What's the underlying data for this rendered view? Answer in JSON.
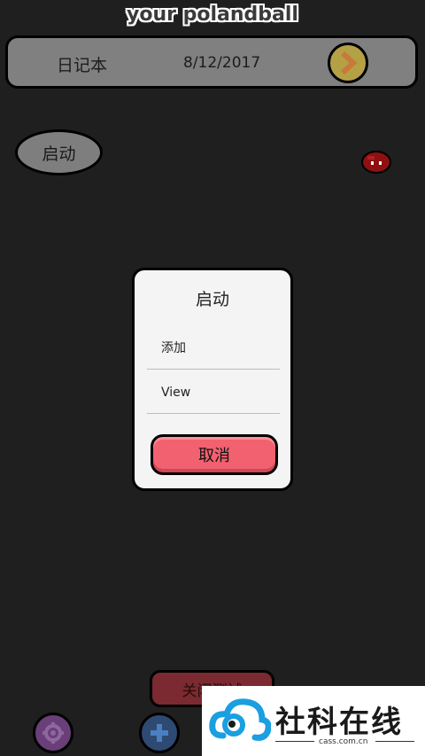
{
  "app": {
    "title": "your polandball"
  },
  "header": {
    "notebook_label": "日记本",
    "date": "8/12/2017"
  },
  "main": {
    "start_label": "启动"
  },
  "dialog": {
    "title": "启动",
    "items": [
      {
        "label": "添加"
      },
      {
        "label": "View"
      }
    ],
    "cancel_label": "取消"
  },
  "bottom": {
    "close_test_label": "关闭测试"
  },
  "watermark": {
    "brand": "社科在线",
    "domain": "cass.com.cn"
  },
  "colors": {
    "background": "#1f1f1f",
    "header": "#808080",
    "cancel": "#f2616f",
    "next_button": "#b4a146",
    "settings_button": "#6a3f79",
    "add_button": "#2e4a73",
    "watermark_blue": "#1a9fe0"
  },
  "icons": [
    "chevron-right-icon",
    "polandball-icon",
    "gear-icon",
    "plus-icon",
    "cloud-logo-icon"
  ]
}
